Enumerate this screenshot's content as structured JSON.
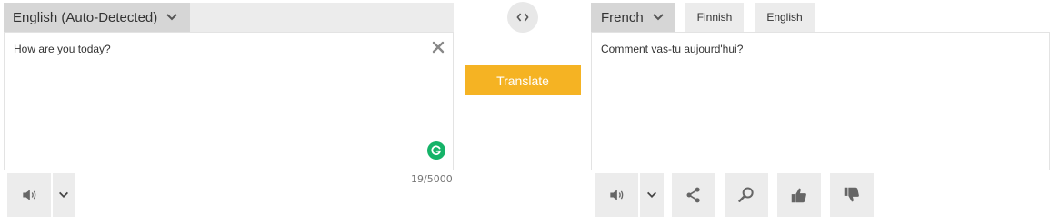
{
  "source": {
    "language_label": "English (Auto-Detected)",
    "text": "How are you today?",
    "char_count": "19/5000"
  },
  "middle": {
    "translate_label": "Translate"
  },
  "target": {
    "language_label": "French",
    "recent_languages": [
      "Finnish",
      "English"
    ],
    "text": "Comment vas-tu aujourd'hui?"
  },
  "icons": {
    "clear": "close-icon",
    "grammarly": "grammarly-icon",
    "swap": "swap-languages-icon",
    "speaker": "speaker-icon",
    "dropdown": "chevron-down-icon",
    "share": "share-icon",
    "search": "search-icon",
    "like": "thumbs-up-icon",
    "dislike": "thumbs-down-icon"
  },
  "colors": {
    "accent": "#f5b323",
    "grammarly": "#15b368",
    "header_gray": "#ececec",
    "selected_gray": "#d6d6d6"
  }
}
